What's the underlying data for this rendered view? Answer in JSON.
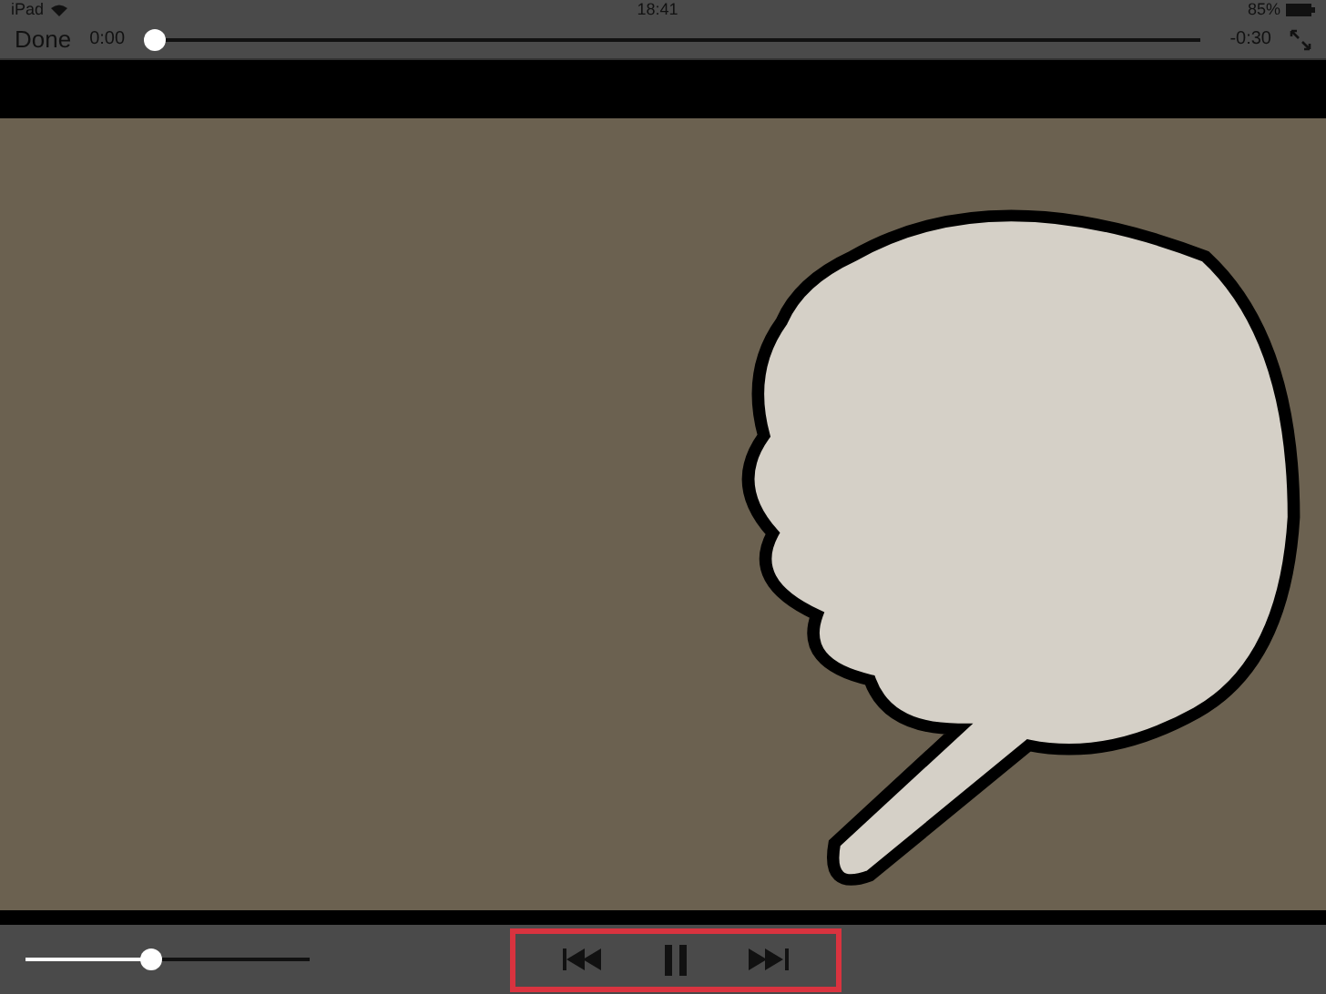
{
  "status_bar": {
    "carrier": "iPad",
    "time": "18:41",
    "battery": "85%"
  },
  "top_bar": {
    "done": "Done",
    "elapsed": "0:00",
    "remaining": "-0:30",
    "scrubber": {
      "level": 0
    }
  },
  "bottom_bar": {
    "volume": {
      "level": 0.44
    },
    "controls_highlighted": true
  }
}
